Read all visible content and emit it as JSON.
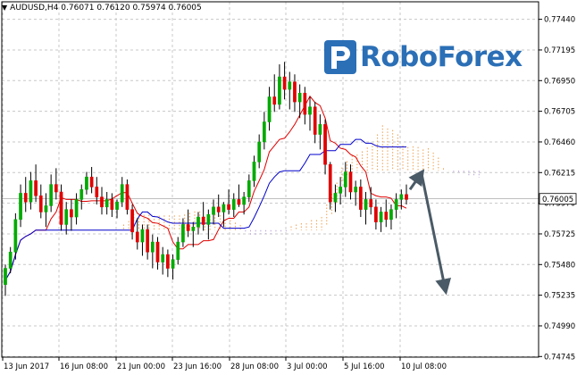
{
  "header": {
    "symbol_tf": "AUDUSD,H4",
    "ohlc": "0.76071 0.76120 0.75974 0.76005"
  },
  "logo": {
    "text": "RoboForex"
  },
  "colors": {
    "tenkan": "#e00000",
    "kijun": "#0000cc",
    "cloud_bull": "#f0a050",
    "cloud_bear": "#b8a0d8",
    "arrow": "#4a5a66",
    "grid": "#c8c8c8",
    "logo_blue": "#2b6fb6"
  },
  "chart_data": {
    "type": "candlestick",
    "title": "AUDUSD,H4",
    "ylim": [
      0.7474,
      0.7758
    ],
    "y_ticks": [
      "0.77440",
      "0.77195",
      "0.76950",
      "0.76705",
      "0.76460",
      "0.76215",
      "0.75970",
      "0.75725",
      "0.75480",
      "0.75235",
      "0.74990",
      "0.74745"
    ],
    "x_ticks": [
      "13 Jun 2017",
      "16 Jun 08:00",
      "21 Jun 00:00",
      "23 Jun 16:00",
      "28 Jun 08:00",
      "3 Jul 00:00",
      "5 Jul 16:00",
      "10 Jul 08:00"
    ],
    "current_price": "0.76005",
    "grid": true,
    "candle_colors": {
      "bull": "#00aa00",
      "bear": "#e00000",
      "wick": "#000000"
    },
    "ohlc": [
      [
        0.7532,
        0.7548,
        0.7523,
        0.7545
      ],
      [
        0.7545,
        0.7562,
        0.7541,
        0.7558
      ],
      [
        0.7558,
        0.7589,
        0.7552,
        0.7584
      ],
      [
        0.7584,
        0.7612,
        0.7578,
        0.7605
      ],
      [
        0.7605,
        0.7618,
        0.759,
        0.7598
      ],
      [
        0.7598,
        0.7622,
        0.7592,
        0.7615
      ],
      [
        0.7615,
        0.7628,
        0.7598,
        0.7603
      ],
      [
        0.7603,
        0.7612,
        0.7585,
        0.759
      ],
      [
        0.759,
        0.7605,
        0.7578,
        0.7595
      ],
      [
        0.7595,
        0.762,
        0.759,
        0.7612
      ],
      [
        0.7612,
        0.7625,
        0.76,
        0.7606
      ],
      [
        0.7606,
        0.7612,
        0.7575,
        0.758
      ],
      [
        0.758,
        0.7598,
        0.7572,
        0.7592
      ],
      [
        0.7592,
        0.76,
        0.7575,
        0.7586
      ],
      [
        0.7586,
        0.7605,
        0.758,
        0.76
      ],
      [
        0.76,
        0.7612,
        0.7592,
        0.7608
      ],
      [
        0.7608,
        0.7622,
        0.7604,
        0.7618
      ],
      [
        0.7618,
        0.7626,
        0.7605,
        0.761
      ],
      [
        0.761,
        0.7618,
        0.7596,
        0.7602
      ],
      [
        0.7602,
        0.761,
        0.7588,
        0.7594
      ],
      [
        0.7594,
        0.7606,
        0.7588,
        0.76
      ],
      [
        0.76,
        0.7605,
        0.7586,
        0.7592
      ],
      [
        0.7592,
        0.76,
        0.7585,
        0.7598
      ],
      [
        0.7598,
        0.7618,
        0.7594,
        0.7612
      ],
      [
        0.7612,
        0.7616,
        0.7588,
        0.7592
      ],
      [
        0.7592,
        0.7596,
        0.7568,
        0.7574
      ],
      [
        0.7574,
        0.7585,
        0.756,
        0.7566
      ],
      [
        0.7566,
        0.758,
        0.7555,
        0.7576
      ],
      [
        0.7576,
        0.758,
        0.7552,
        0.7558
      ],
      [
        0.7558,
        0.7572,
        0.7545,
        0.7566
      ],
      [
        0.7566,
        0.757,
        0.7544,
        0.755
      ],
      [
        0.755,
        0.7562,
        0.754,
        0.7556
      ],
      [
        0.7556,
        0.756,
        0.7538,
        0.7545
      ],
      [
        0.7545,
        0.7556,
        0.7536,
        0.7552
      ],
      [
        0.7552,
        0.757,
        0.7548,
        0.7566
      ],
      [
        0.7566,
        0.7585,
        0.7562,
        0.758
      ],
      [
        0.758,
        0.7592,
        0.757,
        0.7575
      ],
      [
        0.7575,
        0.7582,
        0.7562,
        0.7578
      ],
      [
        0.7578,
        0.759,
        0.7572,
        0.7586
      ],
      [
        0.7586,
        0.7598,
        0.7575,
        0.758
      ],
      [
        0.758,
        0.7592,
        0.7568,
        0.7588
      ],
      [
        0.7588,
        0.76,
        0.758,
        0.7594
      ],
      [
        0.7594,
        0.7604,
        0.7586,
        0.759
      ],
      [
        0.759,
        0.7598,
        0.7578,
        0.7596
      ],
      [
        0.7596,
        0.7608,
        0.7588,
        0.7592
      ],
      [
        0.7592,
        0.7605,
        0.7586,
        0.76
      ],
      [
        0.76,
        0.7612,
        0.7594,
        0.7596
      ],
      [
        0.7596,
        0.7606,
        0.7588,
        0.7602
      ],
      [
        0.7602,
        0.762,
        0.7598,
        0.7615
      ],
      [
        0.7615,
        0.7635,
        0.761,
        0.763
      ],
      [
        0.763,
        0.7652,
        0.7625,
        0.7646
      ],
      [
        0.7646,
        0.767,
        0.764,
        0.7662
      ],
      [
        0.7662,
        0.769,
        0.7655,
        0.7682
      ],
      [
        0.7682,
        0.77,
        0.767,
        0.7676
      ],
      [
        0.7676,
        0.7708,
        0.7672,
        0.7698
      ],
      [
        0.7698,
        0.771,
        0.768,
        0.7688
      ],
      [
        0.7688,
        0.7702,
        0.7672,
        0.7694
      ],
      [
        0.7694,
        0.77,
        0.767,
        0.7678
      ],
      [
        0.7678,
        0.7692,
        0.7665,
        0.7685
      ],
      [
        0.7685,
        0.769,
        0.766,
        0.7668
      ],
      [
        0.7668,
        0.7682,
        0.7655,
        0.7674
      ],
      [
        0.7674,
        0.7678,
        0.7645,
        0.7652
      ],
      [
        0.7652,
        0.7668,
        0.764,
        0.766
      ],
      [
        0.766,
        0.7664,
        0.762,
        0.7628
      ],
      [
        0.7628,
        0.763,
        0.7592,
        0.7598
      ],
      [
        0.7598,
        0.7612,
        0.759,
        0.7605
      ],
      [
        0.7605,
        0.7618,
        0.7596,
        0.761
      ],
      [
        0.761,
        0.763,
        0.7602,
        0.7622
      ],
      [
        0.7622,
        0.7628,
        0.76,
        0.7606
      ],
      [
        0.7606,
        0.7615,
        0.7595,
        0.761
      ],
      [
        0.761,
        0.7616,
        0.7586,
        0.7592
      ],
      [
        0.7592,
        0.7606,
        0.758,
        0.76
      ],
      [
        0.76,
        0.761,
        0.7588,
        0.7594
      ],
      [
        0.7594,
        0.76,
        0.7576,
        0.7582
      ],
      [
        0.7582,
        0.7594,
        0.7574,
        0.759
      ],
      [
        0.759,
        0.76,
        0.7578,
        0.7584
      ],
      [
        0.7584,
        0.7596,
        0.7576,
        0.7592
      ],
      [
        0.7592,
        0.7605,
        0.7585,
        0.76
      ],
      [
        0.76,
        0.7608,
        0.7592,
        0.7604
      ],
      [
        0.7604,
        0.7612,
        0.7596,
        0.76
      ]
    ]
  },
  "overlay": {
    "arrow": {
      "description": "forecast path",
      "points": [
        [
          0.7608,
          0.7622
        ],
        [
          0.7622,
          0.753
        ]
      ]
    }
  }
}
